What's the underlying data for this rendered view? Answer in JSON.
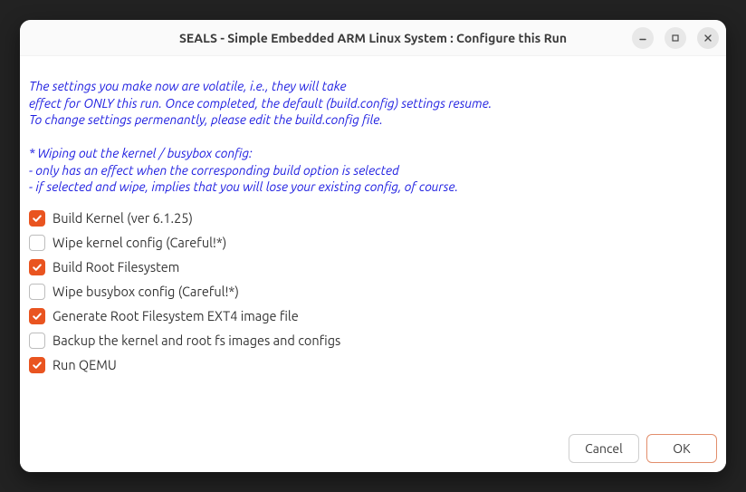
{
  "window": {
    "title": "SEALS - Simple Embedded ARM Linux System : Configure this Run"
  },
  "info": {
    "line1": "The settings you make now are volatile, i.e., they will take",
    "line2": "effect for ONLY this run. Once completed, the default (build.config) settings resume.",
    "line3": "To change settings permenantly, please edit the build.config file.",
    "line4": "",
    "line5": "* Wiping out the kernel / busybox config:",
    "line6": "- only has an effect when the corresponding build option is selected",
    "line7": "- if selected and wipe, implies that you will lose your existing config, of course."
  },
  "options": [
    {
      "label": "Build Kernel (ver 6.1.25)",
      "checked": true
    },
    {
      "label": "Wipe kernel config (Careful!*)",
      "checked": false
    },
    {
      "label": "Build Root Filesystem",
      "checked": true
    },
    {
      "label": "Wipe busybox config (Careful!*)",
      "checked": false
    },
    {
      "label": "Generate Root Filesystem EXT4 image file",
      "checked": true
    },
    {
      "label": "Backup the kernel and root fs images and configs",
      "checked": false
    },
    {
      "label": "Run QEMU",
      "checked": true
    }
  ],
  "buttons": {
    "cancel": "Cancel",
    "ok": "OK"
  },
  "colors": {
    "accent": "#e95420",
    "info_text": "#1c1ce0"
  }
}
